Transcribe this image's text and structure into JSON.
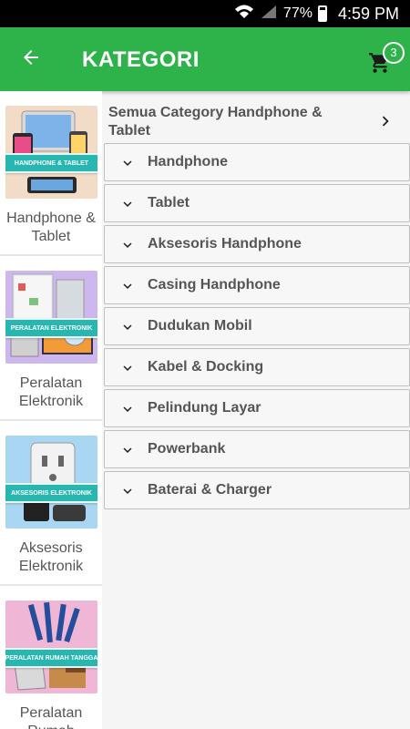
{
  "status_bar": {
    "battery": "77%",
    "time": "4:59 PM"
  },
  "app_bar": {
    "title": "KATEGORI",
    "cart_count": "3"
  },
  "sidebar": [
    {
      "label": "Handphone & Tablet",
      "banner": "HANDPHONE & TABLET",
      "thumb_bg": "#f2dcc8"
    },
    {
      "label": "Peralatan Elektronik",
      "banner": "PERALATAN ELEKTRONIK",
      "thumb_bg": "#cdb7ee"
    },
    {
      "label": "Aksesoris Elektronik",
      "banner": "AKSESORIS ELEKTRONIK",
      "thumb_bg": "#a9d6f2"
    },
    {
      "label": "Peralatan Rumah",
      "banner": "PERALATAN RUMAH TANGGA",
      "thumb_bg": "#f0b6d6"
    }
  ],
  "content": {
    "all_text": "Semua Category Handphone & Tablet",
    "categories": [
      "Handphone",
      "Tablet",
      "Aksesoris Handphone",
      "Casing Handphone",
      "Dudukan Mobil",
      "Kabel & Docking",
      "Pelindung Layar",
      "Powerbank",
      "Baterai & Charger"
    ]
  },
  "colors": {
    "primary": "#2db34a",
    "banner": "#27b7b0"
  }
}
